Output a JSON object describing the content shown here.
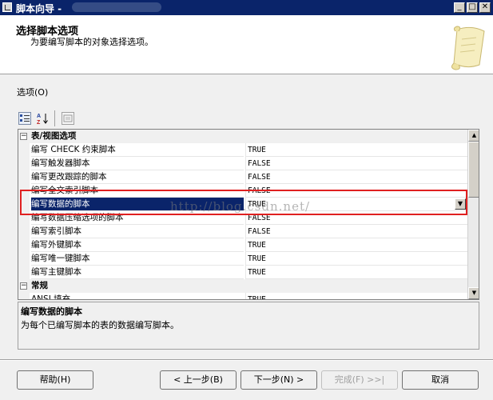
{
  "window": {
    "title": "脚本向导 - ",
    "minimize_label": "_",
    "maximize_label": "□",
    "close_label": "✕"
  },
  "header": {
    "title": "选择脚本选项",
    "subtitle": "为要编写脚本的对象选择选项。"
  },
  "options_label": "选项(O)",
  "toolbar": {
    "sort_alpha_label": "A↓"
  },
  "grid": {
    "categories": [
      {
        "label": "表/视图选项",
        "toggle": "−",
        "rows": [
          {
            "name": "编写 CHECK 约束脚本",
            "value": "TRUE"
          },
          {
            "name": "编写触发器脚本",
            "value": "FALSE"
          },
          {
            "name": "编写更改跟踪的脚本",
            "value": "FALSE"
          },
          {
            "name": "编写全文索引脚本",
            "value": "FALSE"
          },
          {
            "name": "编写数据的脚本",
            "value": "TRUE",
            "selected": true
          },
          {
            "name": "编写数据压缩选项的脚本",
            "value": "FALSE"
          },
          {
            "name": "编写索引脚本",
            "value": "FALSE"
          },
          {
            "name": "编写外键脚本",
            "value": "TRUE"
          },
          {
            "name": "编写唯一键脚本",
            "value": "TRUE"
          },
          {
            "name": "编写主键脚本",
            "value": "TRUE"
          }
        ]
      },
      {
        "label": "常规",
        "toggle": "−",
        "rows": [
          {
            "name": "ANSI 填充",
            "value": "TRUE"
          }
        ]
      }
    ],
    "dropdown_glyph": "▼",
    "scroll_up_glyph": "▲",
    "scroll_down_glyph": "▼"
  },
  "watermark": "http://blog.csdn.net/",
  "description": {
    "title": "编写数据的脚本",
    "text": "为每个已编写脚本的表的数据编写脚本。"
  },
  "buttons": {
    "help": "帮助(H)",
    "back": "< 上一步(B)",
    "next": "下一步(N) >",
    "finish": "完成(F) >>|",
    "cancel": "取消"
  },
  "colors": {
    "title_bar": "#0a246a",
    "selection": "#0a246a",
    "highlight_box": "#e02020"
  }
}
